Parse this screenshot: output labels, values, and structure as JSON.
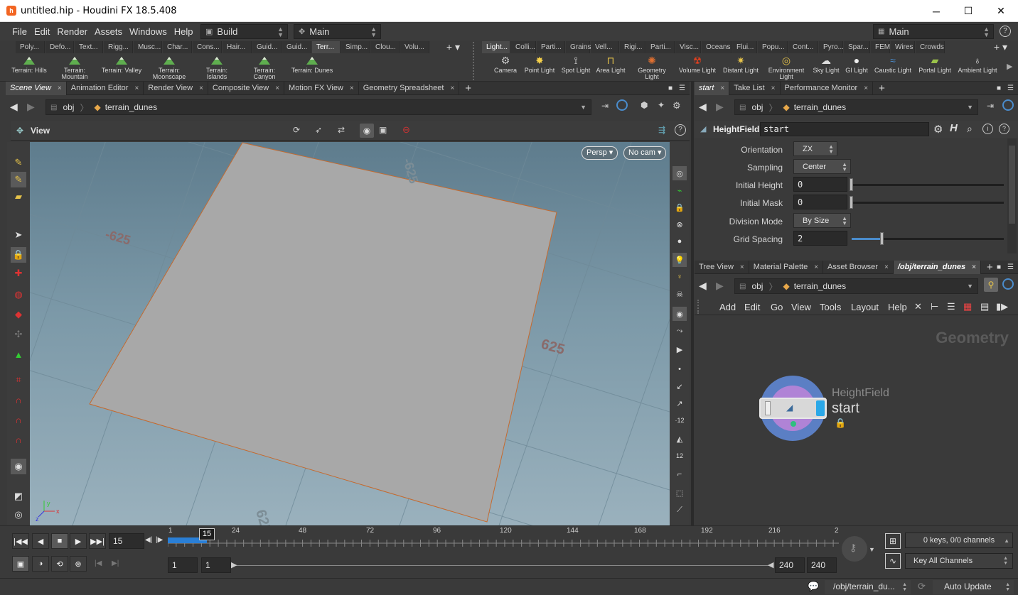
{
  "window": {
    "title": "untitled.hip - Houdini FX 18.5.408",
    "minimize": "─",
    "maximize": "☐",
    "close": "✕"
  },
  "menu": {
    "items": [
      "File",
      "Edit",
      "Render",
      "Assets",
      "Windows",
      "Help"
    ]
  },
  "desktops": {
    "build": "Build",
    "main": "Main",
    "right_main": "Main"
  },
  "shelf_left": {
    "tabs": [
      "Poly...",
      "Defo...",
      "Text...",
      "Rigg...",
      "Musc...",
      "Char...",
      "Cons...",
      "Hair...",
      "Guid...",
      "Guid...",
      "Terr...",
      "Simp...",
      "Clou...",
      "Volu..."
    ],
    "active_tab": "Terr...",
    "tools": [
      "Terrain: Hills",
      "Terrain: Mountain",
      "Terrain: Valley",
      "Terrain: Moonscape",
      "Terrain: Islands",
      "Terrain: Canyon",
      "Terrain: Dunes"
    ]
  },
  "shelf_right": {
    "tabs": [
      "Light...",
      "Colli...",
      "Parti...",
      "Grains",
      "Vell...",
      "Rigi...",
      "Parti...",
      "Visc...",
      "Oceans",
      "Flui...",
      "Popu...",
      "Cont...",
      "Pyro...",
      "Spar...",
      "FEM",
      "Wires",
      "Crowds"
    ],
    "tools": [
      "Camera",
      "Point Light",
      "Spot Light",
      "Area Light",
      "Geometry Light",
      "Volume Light",
      "Distant Light",
      "Environment Light",
      "Sky Light",
      "GI Light",
      "Caustic Light",
      "Portal Light",
      "Ambient Light"
    ]
  },
  "left_pane": {
    "tabs": [
      "Scene View",
      "Animation Editor",
      "Render View",
      "Composite View",
      "Motion FX View",
      "Geometry Spreadsheet"
    ],
    "path": {
      "root": "obj",
      "node": "terrain_dunes"
    },
    "view_label": "View",
    "persp": "Persp ▾",
    "cam": "No cam ▾",
    "grid_labels": [
      "-625",
      "-625",
      "625",
      "625"
    ]
  },
  "param_pane": {
    "tabs": [
      "start",
      "Take List",
      "Performance Monitor"
    ],
    "path": {
      "root": "obj",
      "node": "terrain_dunes"
    },
    "node_type": "HeightField",
    "node_name": "start",
    "params": [
      {
        "label": "Orientation",
        "value": "ZX",
        "kind": "menu"
      },
      {
        "label": "Sampling",
        "value": "Center",
        "kind": "menu"
      },
      {
        "label": "Initial Height",
        "value": "0",
        "kind": "float",
        "fraction": 0.0
      },
      {
        "label": "Initial Mask",
        "value": "0",
        "kind": "float",
        "fraction": 0.0
      },
      {
        "label": "Division Mode",
        "value": "By Size",
        "kind": "menu"
      },
      {
        "label": "Grid Spacing",
        "value": "2",
        "kind": "float",
        "fraction": 0.2
      }
    ]
  },
  "network_pane": {
    "tabs": [
      "Tree View",
      "Material Palette",
      "Asset Browser",
      "/obj/terrain_dunes"
    ],
    "path": {
      "root": "obj",
      "node": "terrain_dunes"
    },
    "menu": [
      "Add",
      "Edit",
      "Go",
      "View",
      "Tools",
      "Layout",
      "Help"
    ],
    "context_label": "Geometry",
    "node": {
      "type": "HeightField",
      "name": "start"
    }
  },
  "timeline": {
    "current_frame": "15",
    "marker": "15",
    "ticks": [
      "1",
      "24",
      "48",
      "72",
      "96",
      "120",
      "144",
      "168",
      "192",
      "216",
      "2"
    ],
    "start": "1",
    "start2": "1",
    "end": "240",
    "end2": "240",
    "keys_info": "0 keys, 0/0 channels",
    "key_all": "Key All Channels"
  },
  "status": {
    "path": "/obj/terrain_du...",
    "update_mode": "Auto Update"
  },
  "colors": {
    "accent_blue": "#2a7fd6",
    "node_ring": "#5b7fc4",
    "node_inner": "#b083d6",
    "viewport_top": "#5e7c8d",
    "viewport_bottom": "#9ab1bd",
    "plane": "#a8a8a8"
  }
}
